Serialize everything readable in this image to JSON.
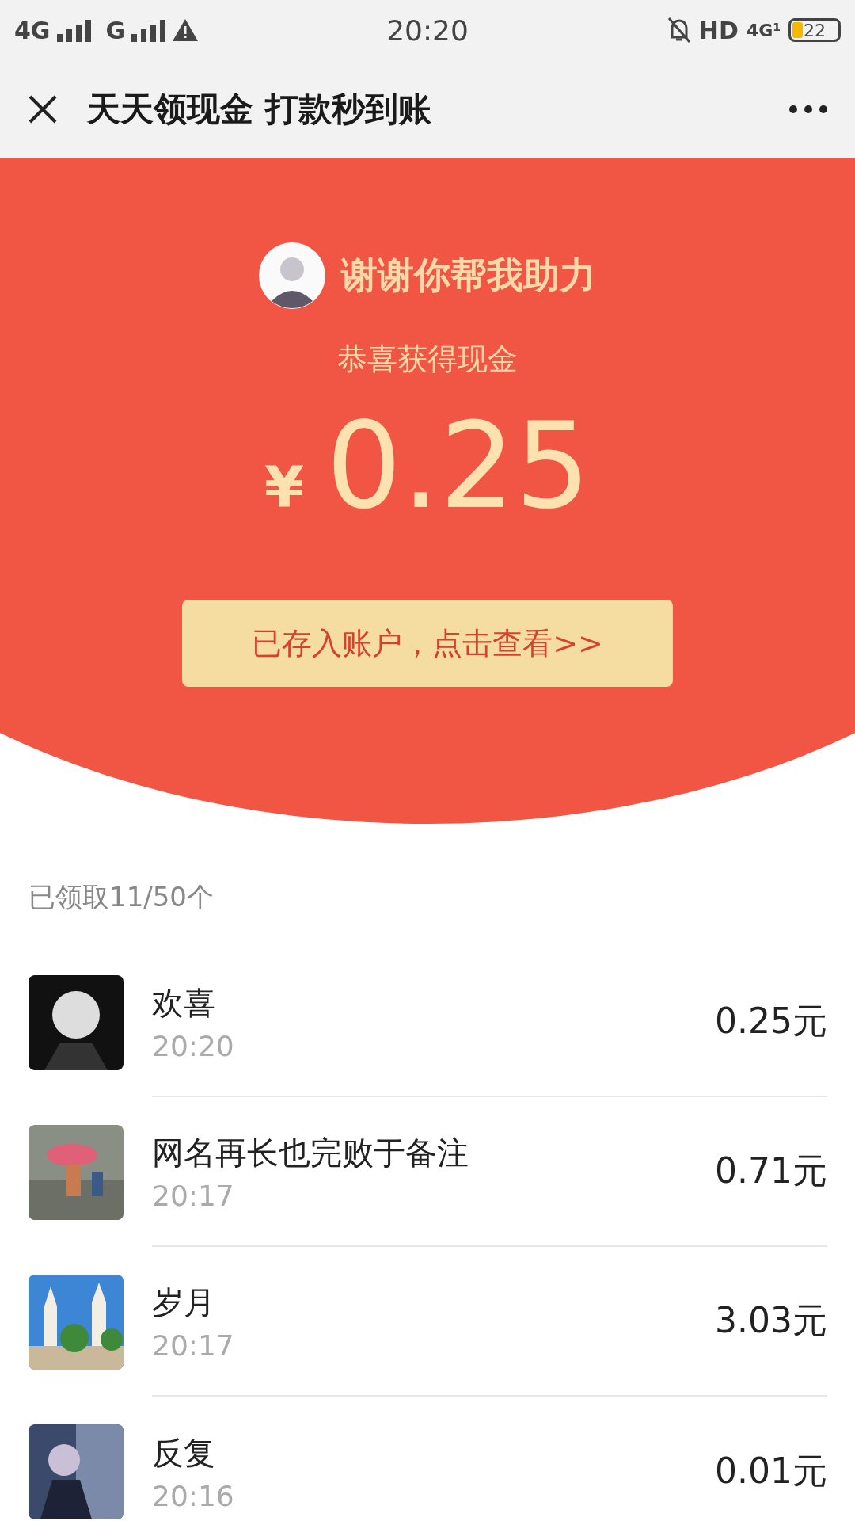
{
  "status_bar": {
    "network_1": "4G",
    "network_2": "G",
    "time": "20:20",
    "hd": "HD",
    "network_3": "4G",
    "network_3_slot": "1",
    "battery": "22"
  },
  "nav": {
    "title": "天天领现金 打款秒到账"
  },
  "hero": {
    "title": "谢谢你帮我助力",
    "subtitle": "恭喜获得现金",
    "currency": "¥",
    "amount": "0.25",
    "button": "已存入账户，点击查看>>"
  },
  "claimed": "已领取11/50个",
  "records": [
    {
      "name": "欢喜",
      "time": "20:20",
      "amount": "0.25元"
    },
    {
      "name": "网名再长也完败于备注",
      "time": "20:17",
      "amount": "0.71元"
    },
    {
      "name": "岁月",
      "time": "20:17",
      "amount": "3.03元"
    },
    {
      "name": "反复",
      "time": "20:16",
      "amount": "0.01元"
    }
  ]
}
